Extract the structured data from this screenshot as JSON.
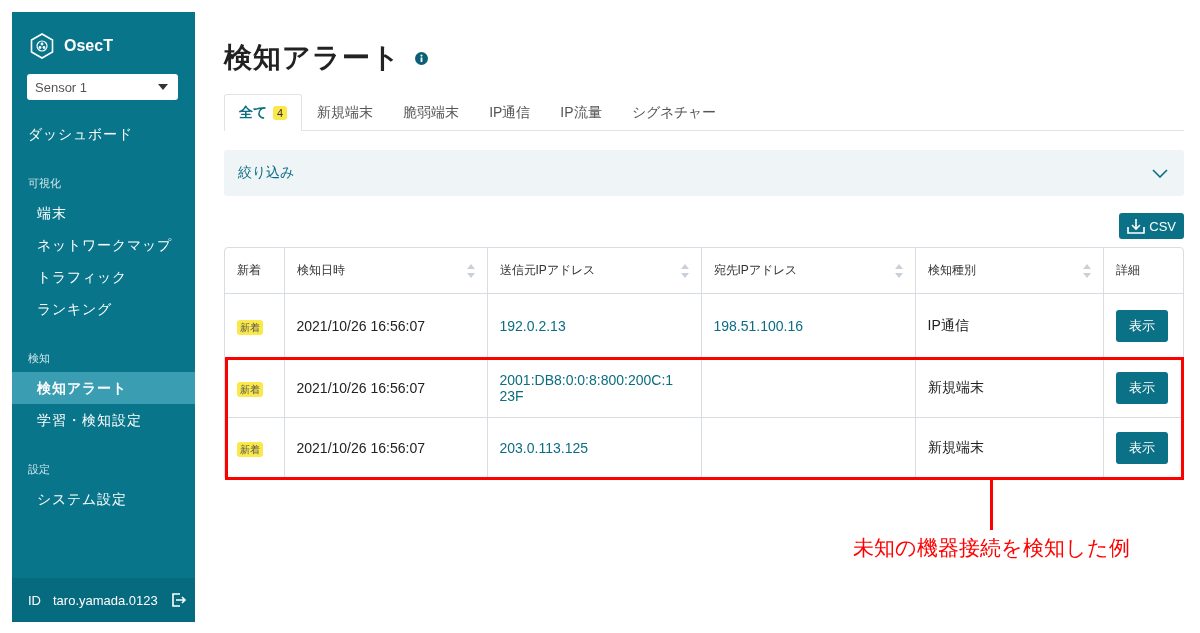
{
  "sidebar": {
    "logo": "OsecT",
    "sensor_select": {
      "value": "Sensor 1"
    },
    "sections": [
      {
        "items": [
          {
            "label": "ダッシュボード",
            "selected": false
          }
        ]
      },
      {
        "heading": "可視化",
        "items": [
          {
            "label": "端末",
            "selected": false
          },
          {
            "label": "ネットワークマップ",
            "selected": false
          },
          {
            "label": "トラフィック",
            "selected": false
          },
          {
            "label": "ランキング",
            "selected": false
          }
        ]
      },
      {
        "heading": "検知",
        "items": [
          {
            "label": "検知アラート",
            "selected": true
          },
          {
            "label": "学習・検知設定",
            "selected": false
          }
        ]
      },
      {
        "heading": "設定",
        "items": [
          {
            "label": "システム設定",
            "selected": false
          }
        ]
      }
    ],
    "footer": {
      "id_label": "ID",
      "user": "taro.yamada.0123"
    }
  },
  "page": {
    "title": "検知アラート",
    "tabs": [
      {
        "label": "全て",
        "badge": "4",
        "selected": true
      },
      {
        "label": "新規端末",
        "selected": false
      },
      {
        "label": "脆弱端末",
        "selected": false
      },
      {
        "label": "IP通信",
        "selected": false
      },
      {
        "label": "IP流量",
        "selected": false
      },
      {
        "label": "シグネチャー",
        "selected": false
      }
    ],
    "filter": {
      "label": "絞り込み",
      "expanded": false
    },
    "csv_button": "CSV",
    "table": {
      "columns": [
        {
          "label": "新着",
          "sortable": false
        },
        {
          "label": "検知日時",
          "sortable": true
        },
        {
          "label": "送信元IPアドレス",
          "sortable": true
        },
        {
          "label": "宛先IPアドレス",
          "sortable": true
        },
        {
          "label": "検知種別",
          "sortable": true
        },
        {
          "label": "詳細",
          "sortable": false
        }
      ],
      "rows": [
        {
          "new": "新着",
          "datetime": "2021/10/26 16:56:07",
          "source_ip": "192.0.2.13",
          "dest_ip": "198.51.100.16",
          "type": "IP通信",
          "action": "表示",
          "highlighted": false
        },
        {
          "new": "新着",
          "datetime": "2021/10/26 16:56:07",
          "source_ip": "2001:DB8:0:0:8:800:200C:123F",
          "dest_ip": null,
          "type": "新規端末",
          "action": "表示",
          "highlighted": true
        },
        {
          "new": "新着",
          "datetime": "2021/10/26 16:56:07",
          "source_ip": "203.0.113.125",
          "dest_ip": null,
          "type": "新規端末",
          "action": "表示",
          "highlighted": true
        }
      ]
    }
  },
  "annotation": {
    "text": "未知の機器接続を検知した例"
  }
}
